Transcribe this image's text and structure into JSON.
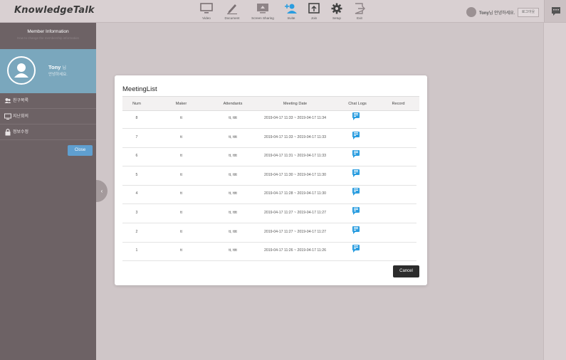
{
  "app": {
    "logo": "KnowledgeTalk"
  },
  "toolbar": [
    {
      "label": "Video",
      "icon": "monitor-icon"
    },
    {
      "label": "Document",
      "icon": "pen-icon"
    },
    {
      "label": "Screen Sharing",
      "icon": "screen-share-icon"
    },
    {
      "label": "Invite",
      "icon": "add-user-icon"
    },
    {
      "label": "Join",
      "icon": "join-icon"
    },
    {
      "label": "Setup",
      "icon": "gear-icon"
    },
    {
      "label": "Exit",
      "icon": "exit-icon"
    }
  ],
  "user": {
    "name": "Tony",
    "greeting": "님 안녕하세요.",
    "logout_label": "로그아웃"
  },
  "sidebar": {
    "header_title": "Member Information",
    "header_subtitle": "How to change the membership information",
    "profile_name": "Tony",
    "profile_suffix": "님",
    "profile_greeting": "안녕하세요.",
    "items": [
      {
        "label": "친구목록",
        "icon": "friends-icon"
      },
      {
        "label": "지난회의",
        "icon": "meeting-history-icon"
      },
      {
        "label": "정보수정",
        "icon": "lock-icon"
      }
    ],
    "close_label": "Close"
  },
  "modal": {
    "title": "MeetingList",
    "columns": [
      "Num",
      "Maker",
      "Attendants",
      "Meeting Date",
      "Chat Logs",
      "Record"
    ],
    "rows": [
      {
        "num": "8",
        "maker": "tt",
        "attendants": "tt, tttt",
        "date": "2019-04-17 11:33 ~ 2019-04-17 11:34",
        "chat": true,
        "record": ""
      },
      {
        "num": "7",
        "maker": "tt",
        "attendants": "tt, tttt",
        "date": "2019-04-17 11:33 ~ 2019-04-17 11:33",
        "chat": true,
        "record": ""
      },
      {
        "num": "6",
        "maker": "tt",
        "attendants": "tt, tttt",
        "date": "2019-04-17 11:31 ~ 2019-04-17 11:33",
        "chat": true,
        "record": ""
      },
      {
        "num": "5",
        "maker": "tt",
        "attendants": "tt, tttt",
        "date": "2019-04-17 11:30 ~ 2019-04-17 11:30",
        "chat": true,
        "record": ""
      },
      {
        "num": "4",
        "maker": "tt",
        "attendants": "tt, tttt",
        "date": "2019-04-17 11:28 ~ 2019-04-17 11:30",
        "chat": true,
        "record": ""
      },
      {
        "num": "3",
        "maker": "tt",
        "attendants": "tt, tttt",
        "date": "2019-04-17 11:27 ~ 2019-04-17 11:27",
        "chat": true,
        "record": ""
      },
      {
        "num": "2",
        "maker": "tt",
        "attendants": "tt, tttt",
        "date": "2019-04-17 11:27 ~ 2019-04-17 11:27",
        "chat": true,
        "record": ""
      },
      {
        "num": "1",
        "maker": "tt",
        "attendants": "tt, tttt",
        "date": "2019-04-17 11:26 ~ 2019-04-17 11:26",
        "chat": true,
        "record": ""
      }
    ],
    "cancel_label": "Cancel"
  },
  "colors": {
    "accent": "#2a9de0",
    "sidebar": "#6d6265",
    "profile": "#7aa7bd",
    "close_button": "#5f9fd0"
  }
}
